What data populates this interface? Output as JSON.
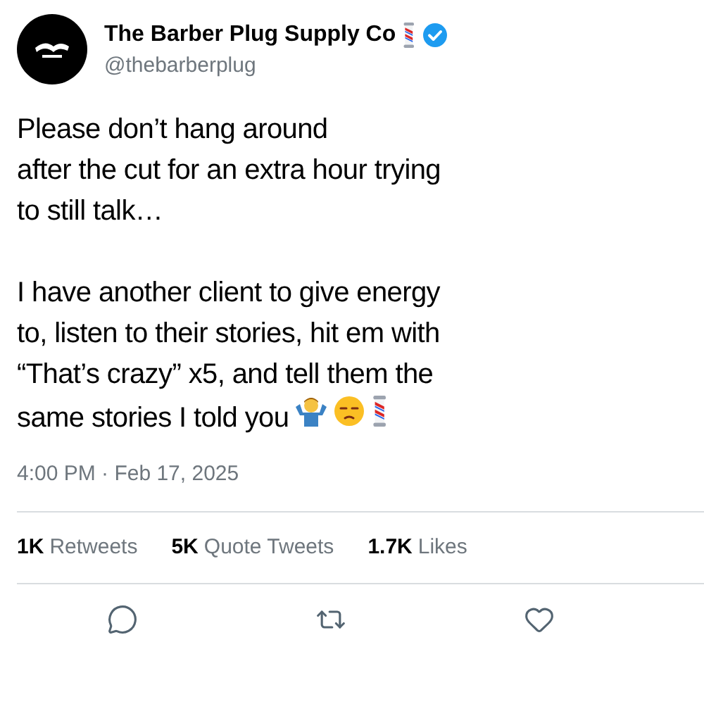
{
  "author": {
    "name": "The Barber Plug Supply Co",
    "handle": "@thebarberplug",
    "verified": true
  },
  "tweet": {
    "paragraphs": [
      {
        "lines": [
          "Please don’t hang around",
          "after the cut for an extra hour trying",
          "to still talk…"
        ]
      },
      {
        "lines": [
          "I have another client to give energy",
          "to, listen to their stories, hit em with",
          "“That’s crazy” x5, and tell them the",
          "same stories I told you"
        ]
      }
    ],
    "timestamp": "4:00 PM · Feb 17, 2025"
  },
  "stats": [
    {
      "count": "1K",
      "label": "Retweets"
    },
    {
      "count": "5K",
      "label": "Quote Tweets"
    },
    {
      "count": "1.7K",
      "label": "Likes"
    }
  ],
  "actions": [
    {
      "kind": "reply"
    },
    {
      "kind": "retweet"
    },
    {
      "kind": "like"
    }
  ]
}
